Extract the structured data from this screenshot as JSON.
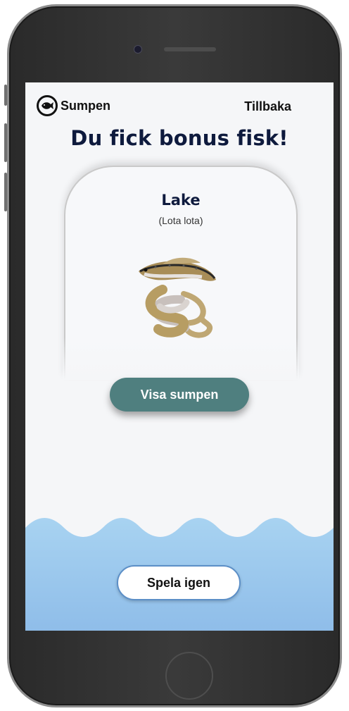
{
  "nav": {
    "home_label": "Sumpen",
    "back_label": "Tillbaka"
  },
  "heading": "Du fick bonus fisk!",
  "fish": {
    "name": "Lake",
    "latin": "(Lota lota)"
  },
  "buttons": {
    "show_sump": "Visa sumpen",
    "play_again": "Spela igen"
  },
  "colors": {
    "primary_button": "#4f7f7f",
    "heading": "#0e1a3d",
    "water_top": "#a8d3f1",
    "water_bottom": "#8fbde9",
    "screen_bg": "#f5f6f8"
  }
}
